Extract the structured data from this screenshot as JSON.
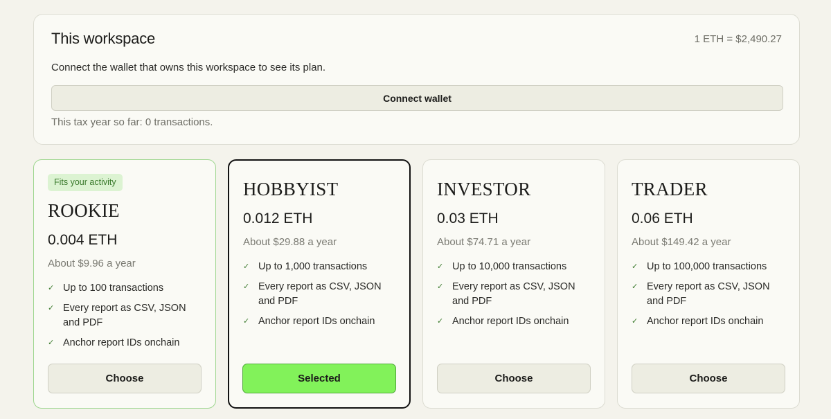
{
  "workspace": {
    "title": "This workspace",
    "rate": "1 ETH = $2,490.27",
    "description": "Connect the wallet that owns this workspace to see its plan.",
    "connect_label": "Connect wallet",
    "note": "This tax year so far: 0 transactions."
  },
  "plans": [
    {
      "badge": "Fits your activity",
      "name": "ROOKIE",
      "price": "0.004 ETH",
      "yearly": "About $9.96 a year",
      "features": [
        "Up to 100 transactions",
        "Every report as CSV, JSON and PDF",
        "Anchor report IDs onchain"
      ],
      "button": "Choose",
      "state": "recommended"
    },
    {
      "name": "HOBBYIST",
      "price": "0.012 ETH",
      "yearly": "About $29.88 a year",
      "features": [
        "Up to 1,000 transactions",
        "Every report as CSV, JSON and PDF",
        "Anchor report IDs onchain"
      ],
      "button": "Selected",
      "state": "selected"
    },
    {
      "name": "INVESTOR",
      "price": "0.03 ETH",
      "yearly": "About $74.71 a year",
      "features": [
        "Up to 10,000 transactions",
        "Every report as CSV, JSON and PDF",
        "Anchor report IDs onchain"
      ],
      "button": "Choose",
      "state": "default"
    },
    {
      "name": "TRADER",
      "price": "0.06 ETH",
      "yearly": "About $149.42 a year",
      "features": [
        "Up to 100,000 transactions",
        "Every report as CSV, JSON and PDF",
        "Anchor report IDs onchain"
      ],
      "button": "Choose",
      "state": "default"
    }
  ],
  "icons": {
    "feature_check": "check-icon"
  },
  "colors": {
    "accent_green": "#82f25a",
    "badge_bg": "#dcf3d2",
    "badge_text": "#3a7a2c"
  }
}
